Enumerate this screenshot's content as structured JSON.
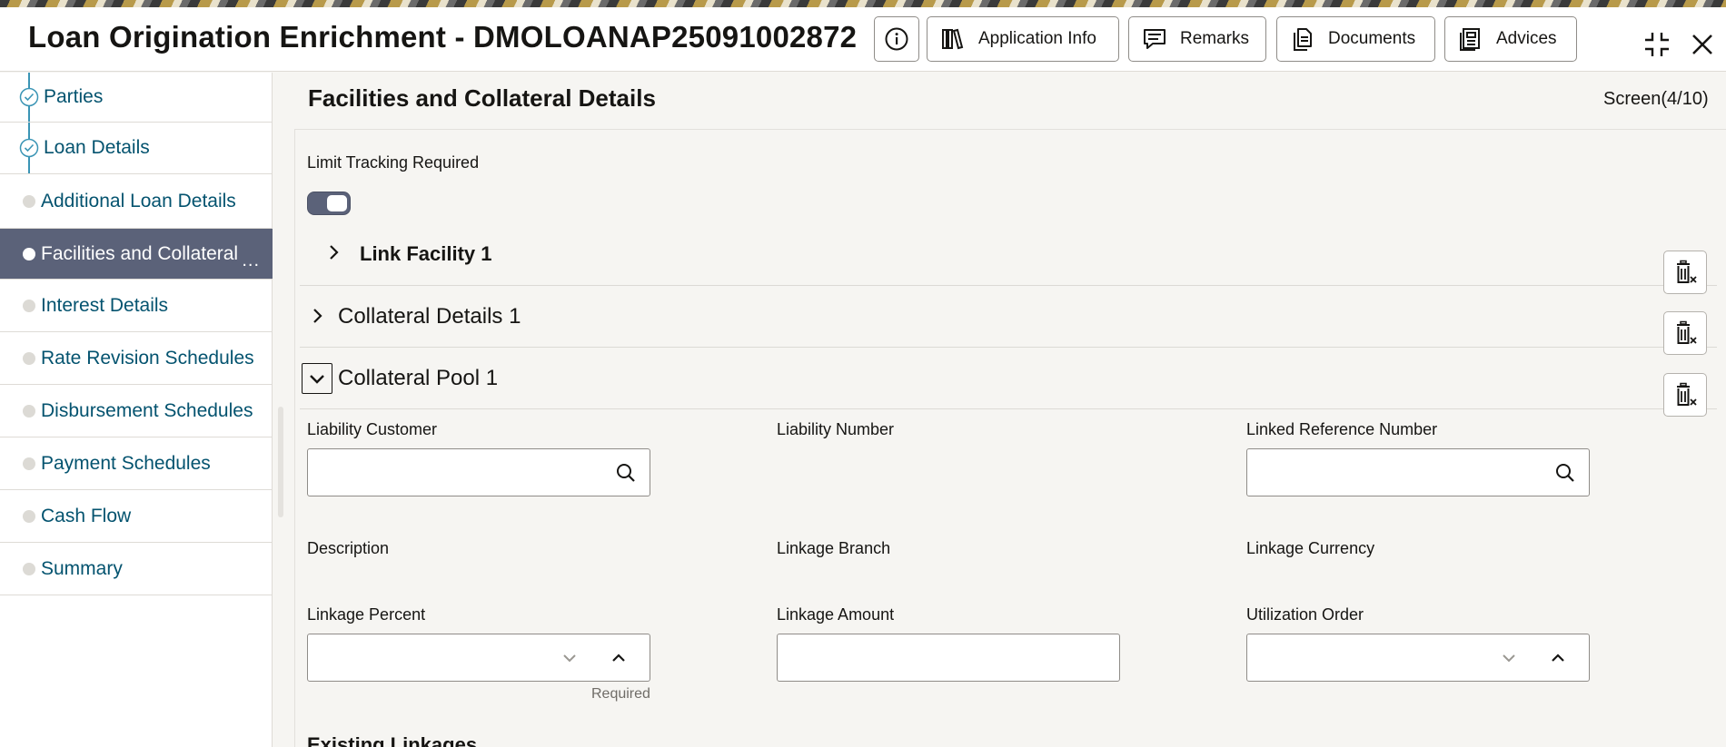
{
  "header": {
    "title": "Loan Origination Enrichment - DMOLOANAP25091002872",
    "buttons": {
      "application_info": "Application Info",
      "remarks": "Remarks",
      "documents": "Documents",
      "advices": "Advices"
    }
  },
  "sidebar": {
    "items": [
      {
        "label": "Parties",
        "state": "done"
      },
      {
        "label": "Loan Details",
        "state": "done"
      },
      {
        "label": "Additional Loan Details",
        "state": "pending"
      },
      {
        "label": "Facilities and Collateral",
        "state": "active"
      },
      {
        "label": "Interest Details",
        "state": "pending"
      },
      {
        "label": "Rate Revision Schedules",
        "state": "pending"
      },
      {
        "label": "Disbursement Schedules",
        "state": "pending"
      },
      {
        "label": "Payment Schedules",
        "state": "pending"
      },
      {
        "label": "Cash Flow",
        "state": "pending"
      },
      {
        "label": "Summary",
        "state": "pending"
      }
    ],
    "more_indicator": "..."
  },
  "main": {
    "title": "Facilities and Collateral Details",
    "screen_counter": "Screen(4/10)",
    "limit_tracking": {
      "label": "Limit Tracking Required",
      "enabled": true
    },
    "sections": [
      {
        "title": "Link Facility 1",
        "expanded": false
      },
      {
        "title": "Collateral Details 1",
        "expanded": false
      },
      {
        "title": "Collateral Pool 1",
        "expanded": true
      }
    ],
    "fields": {
      "liability_customer": {
        "label": "Liability Customer",
        "value": ""
      },
      "liability_number": {
        "label": "Liability Number"
      },
      "linked_reference_number": {
        "label": "Linked Reference Number",
        "value": ""
      },
      "description": {
        "label": "Description"
      },
      "linkage_branch": {
        "label": "Linkage Branch"
      },
      "linkage_currency": {
        "label": "Linkage Currency"
      },
      "linkage_percent": {
        "label": "Linkage Percent",
        "value": "",
        "hint": "Required"
      },
      "linkage_amount": {
        "label": "Linkage Amount",
        "value": ""
      },
      "utilization_order": {
        "label": "Utilization Order",
        "value": ""
      }
    },
    "cutoff_heading": "Existing Linkages"
  },
  "colors": {
    "accent_active": "#5b6279",
    "link_text": "#04536f",
    "progress_line": "#3b95b5"
  }
}
